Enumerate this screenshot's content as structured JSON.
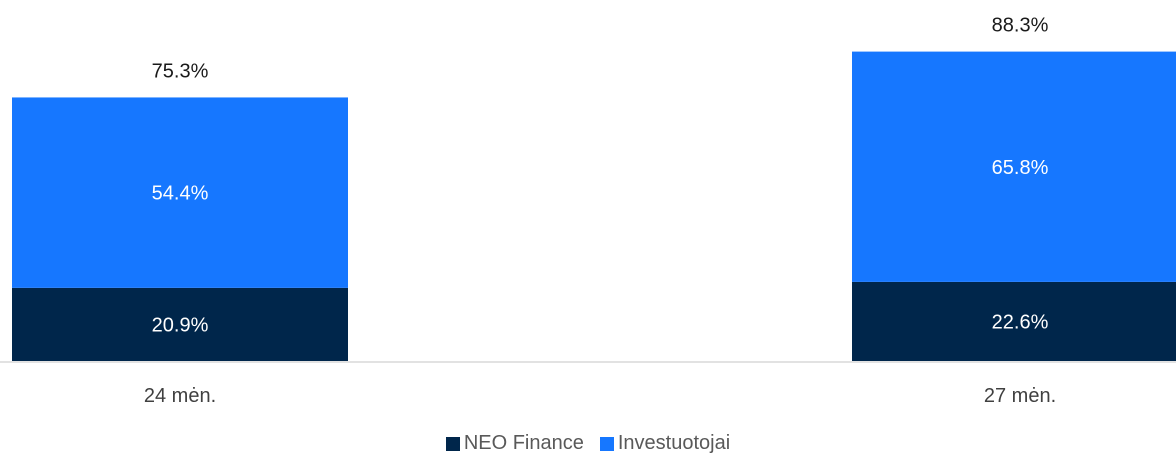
{
  "chart_data": {
    "type": "bar",
    "stacked": true,
    "categories": [
      "24 mėn.",
      "27 mėn."
    ],
    "series": [
      {
        "name": "NEO Finance",
        "values": [
          20.9,
          22.6
        ],
        "labels": [
          "20.9%",
          "22.6%"
        ],
        "color": "#00264b"
      },
      {
        "name": "Investuotojai",
        "values": [
          54.4,
          65.8
        ],
        "labels": [
          "54.4%",
          "65.8%"
        ],
        "color": "#1677ff"
      }
    ],
    "totals": [
      75.3,
      88.3
    ],
    "total_labels": [
      "75.3%",
      "88.3%"
    ],
    "legend": "bottom-center",
    "grid": false
  }
}
